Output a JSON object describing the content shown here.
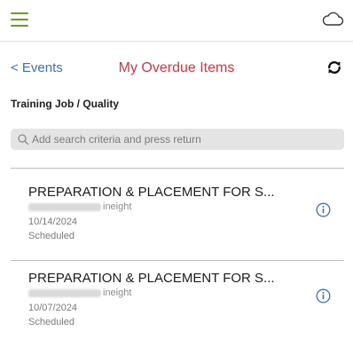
{
  "header": {
    "menu_icon": "hamburger-menu-icon",
    "cloud_icon": "cloud-icon",
    "accent_color": "#6f9a2e"
  },
  "nav": {
    "back_label": "< Events",
    "title": "My Overdue Items",
    "refresh_icon": "refresh-icon",
    "link_color": "#3b6fb6",
    "title_color": "#d9343d"
  },
  "breadcrumb": "Training Job / Quality",
  "search": {
    "placeholder": "Add search criteria and press return",
    "value": ""
  },
  "items": [
    {
      "title": "PREPARATION & PLACEMENT FOR S...",
      "subtitle_visible": "ineight",
      "date": "10/14/2024",
      "status": "Scheduled"
    },
    {
      "title": "PREPARATION & PLACEMENT FOR S...",
      "subtitle_visible": "ineight",
      "date": "10/07/2024",
      "status": "Scheduled"
    }
  ]
}
